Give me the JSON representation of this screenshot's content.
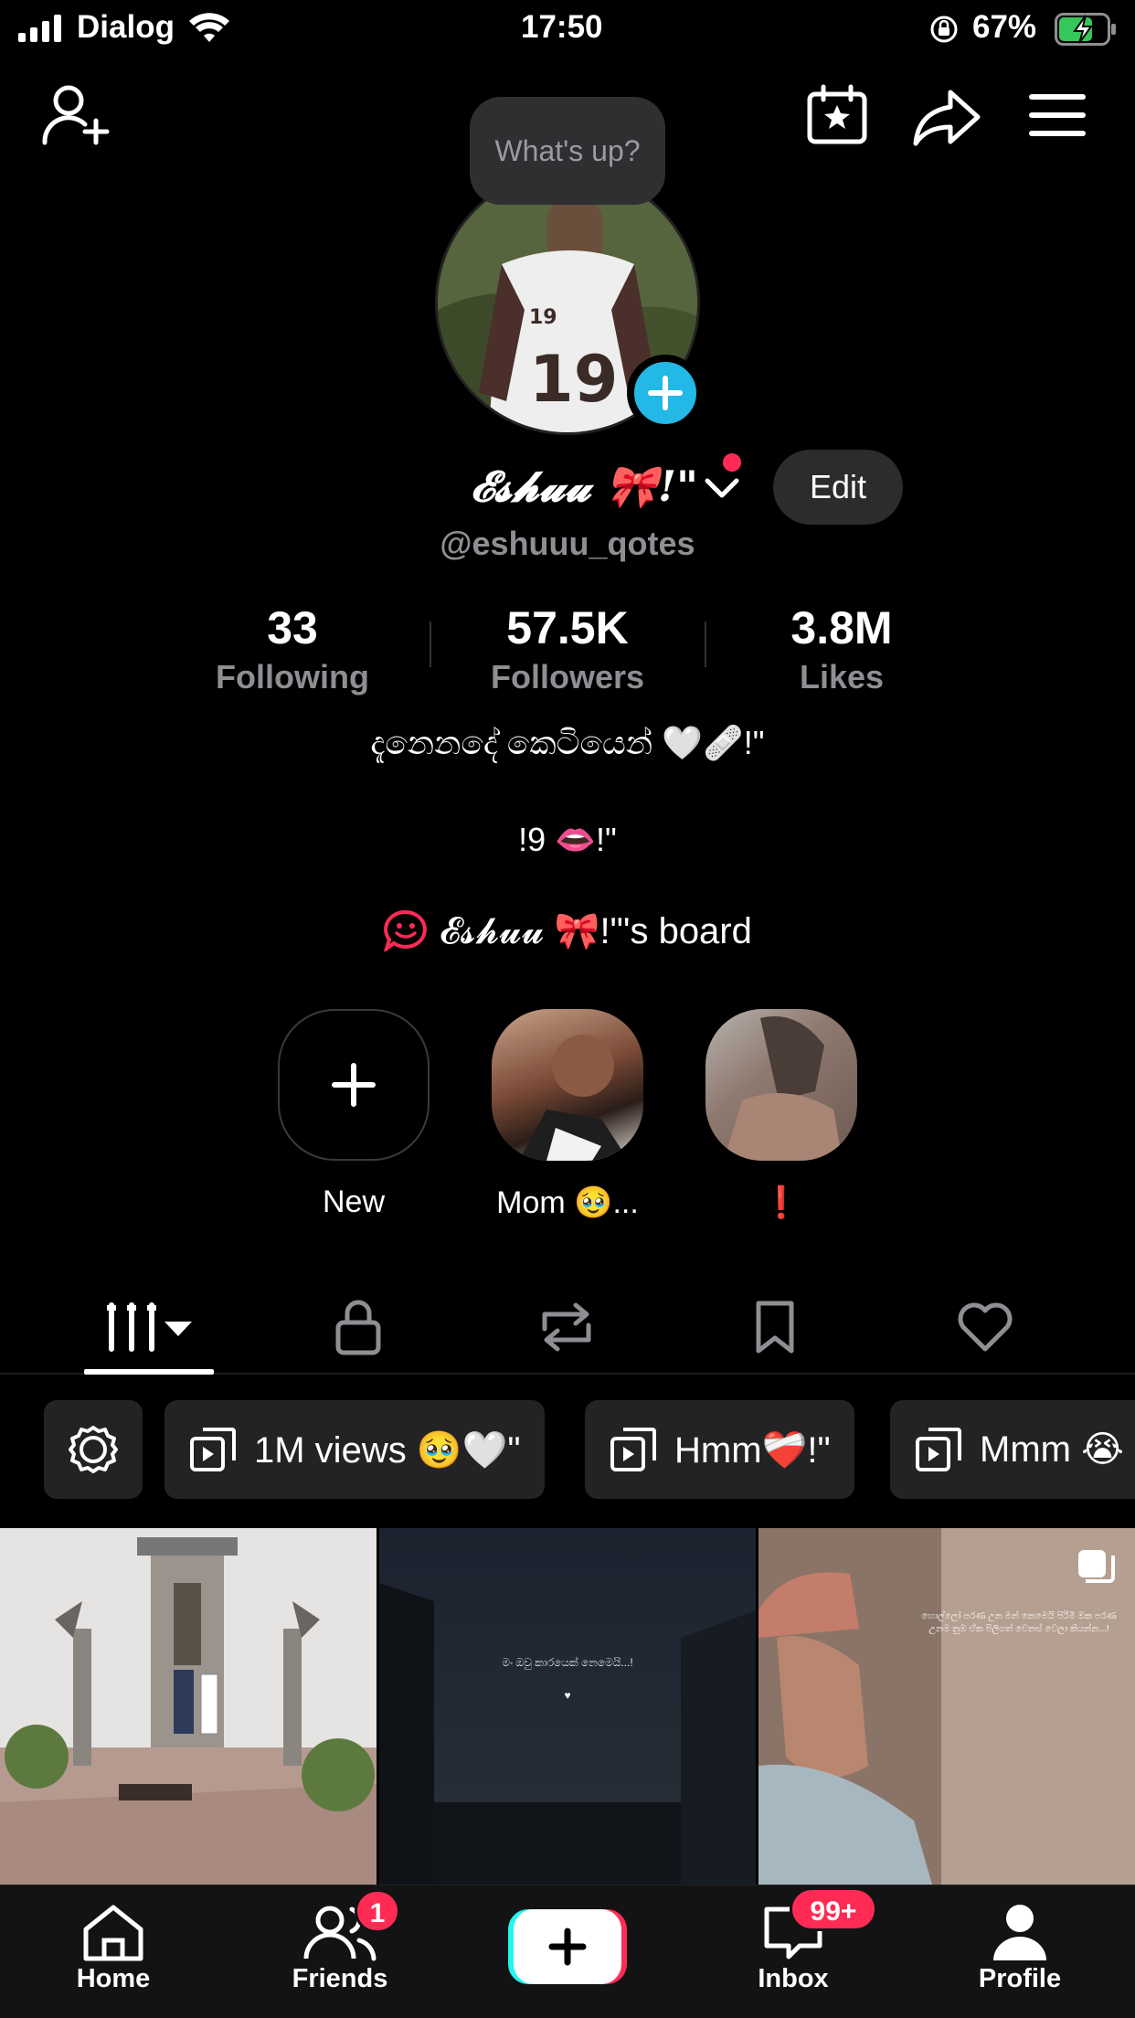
{
  "status_bar": {
    "carrier": "Dialog",
    "time": "17:50",
    "battery": "67%"
  },
  "tooltip": "What's up?",
  "profile": {
    "display_name": "𝓔𝓼𝓱𝓾𝓾 🎀!\"",
    "edit_label": "Edit",
    "handle": "@eshuuu_qotes"
  },
  "stats": [
    {
      "value": "33",
      "label": "Following"
    },
    {
      "value": "57.5K",
      "label": "Followers"
    },
    {
      "value": "3.8M",
      "label": "Likes"
    }
  ],
  "bio": {
    "line1": "දැනෙනදේ කෙටියෙන් 🤍🩹!\"",
    "line2": "!9 👄!\"",
    "board": "𝓔𝓼𝓱𝓾𝓾 🎀!\"'s board"
  },
  "highlights": [
    {
      "label": "New"
    },
    {
      "label": "Mom 🥹..."
    },
    {
      "label": "❗"
    }
  ],
  "playlists": [
    {
      "label": "1M views 🥹🤍\""
    },
    {
      "label": "Hmm❤️‍🩹!\""
    },
    {
      "label": "Mmm 😭"
    }
  ],
  "videos": [
    {
      "overlay": ""
    },
    {
      "overlay": "මං ඔවු කාරයෙක් නෙමෙයි...!"
    },
    {
      "overlay": "හොල්ලෝ පරණ උන මන් නෙමෙයි පිරිමි ඔක පරණ උනම නුඹ ඒක පිලිගත් වෙනස් වෙලා කියන්න...!"
    }
  ],
  "nav": {
    "home": "Home",
    "friends": "Friends",
    "friends_badge": "1",
    "inbox": "Inbox",
    "inbox_badge": "99+",
    "profile": "Profile"
  },
  "colors": {
    "accent_blue": "#23b8e6",
    "badge_red": "#ff2b55",
    "create_cyan": "#25f4ee",
    "create_pink": "#fe2c55"
  }
}
